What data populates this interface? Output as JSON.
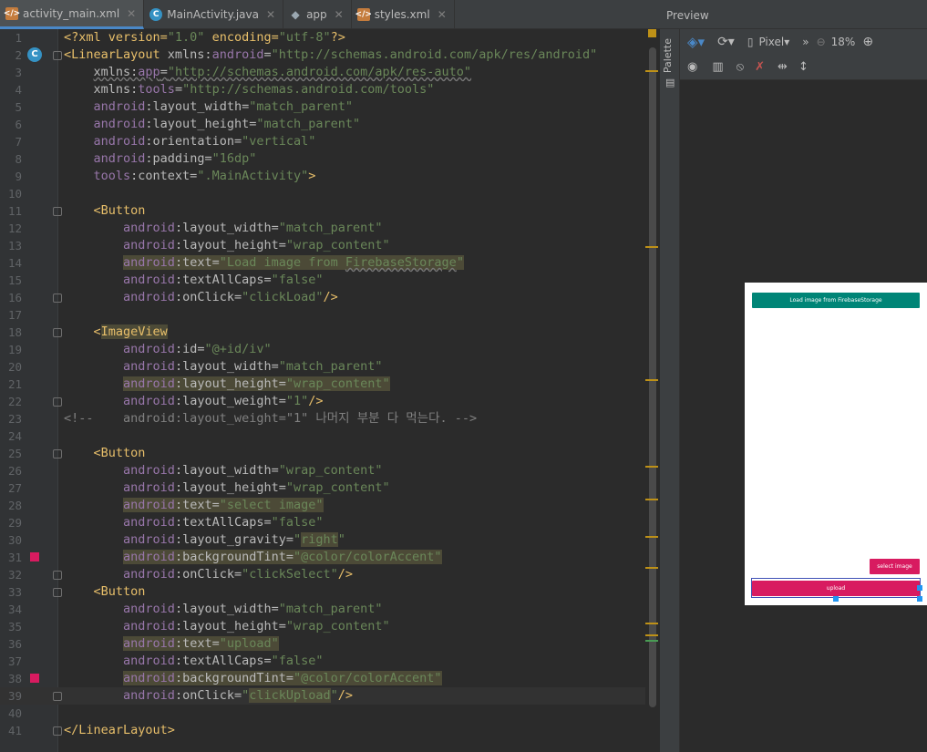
{
  "tabs": [
    {
      "label": "activity_main.xml",
      "icon": "xml-file-icon",
      "active": true
    },
    {
      "label": "MainActivity.java",
      "icon": "java-class-icon",
      "active": false
    },
    {
      "label": "app",
      "icon": "module-icon",
      "active": false
    },
    {
      "label": "styles.xml",
      "icon": "xml-file-icon",
      "active": false
    }
  ],
  "code_lines": [
    {
      "n": "1",
      "html": "<span class=\"pi\">&lt;?xml version=</span><span class=\"val\">\"1.0\"</span><span class=\"pi\"> encoding=</span><span class=\"val\">\"utf-8\"</span><span class=\"pi\">?&gt;</span>"
    },
    {
      "n": "2",
      "html": "<span class=\"tag\">&lt;LinearLayout </span><span class=\"attr\">xmlns:</span><span class=\"ns\">android</span><span class=\"attr\">=</span><span class=\"val\">\"http://schemas.android.com/apk/res/android\"</span>"
    },
    {
      "n": "3",
      "html": "    <span class=\"attr err\">xmlns:</span><span class=\"ns err\">app</span><span class=\"attr err\">=</span><span class=\"val err\">\"http://schemas.android.com/apk/res-auto\"</span>"
    },
    {
      "n": "4",
      "html": "    <span class=\"attr\">xmlns:</span><span class=\"ns\">tools</span><span class=\"attr\">=</span><span class=\"val\">\"http://schemas.android.com/tools\"</span>"
    },
    {
      "n": "5",
      "html": "    <span class=\"ns\">android</span><span class=\"attr\">:layout_width=</span><span class=\"val\">\"match_parent\"</span>"
    },
    {
      "n": "6",
      "html": "    <span class=\"ns\">android</span><span class=\"attr\">:layout_height=</span><span class=\"val\">\"match_parent\"</span>"
    },
    {
      "n": "7",
      "html": "    <span class=\"ns\">android</span><span class=\"attr\">:orientation=</span><span class=\"val\">\"vertical\"</span>"
    },
    {
      "n": "8",
      "html": "    <span class=\"ns\">android</span><span class=\"attr\">:padding=</span><span class=\"val\">\"16dp\"</span>"
    },
    {
      "n": "9",
      "html": "    <span class=\"ns\">tools</span><span class=\"attr\">:context=</span><span class=\"val\">\".MainActivity\"</span><span class=\"tag\">&gt;</span>"
    },
    {
      "n": "10",
      "html": ""
    },
    {
      "n": "11",
      "html": "    <span class=\"tag\">&lt;Button</span>"
    },
    {
      "n": "12",
      "html": "        <span class=\"ns\">android</span><span class=\"attr\">:layout_width=</span><span class=\"val\">\"match_parent\"</span>"
    },
    {
      "n": "13",
      "html": "        <span class=\"ns\">android</span><span class=\"attr\">:layout_height=</span><span class=\"val\">\"wrap_content\"</span>"
    },
    {
      "n": "14",
      "html": "        <span class=\"hl\"><span class=\"ns\">android</span><span class=\"attr\">:text=</span><span class=\"val\">\"Load image from <span class=\"err\">FirebaseStorage</span>\"</span></span>"
    },
    {
      "n": "15",
      "html": "        <span class=\"ns\">android</span><span class=\"attr\">:textAllCaps=</span><span class=\"val\">\"false\"</span>"
    },
    {
      "n": "16",
      "html": "        <span class=\"ns\">android</span><span class=\"attr\">:onClick=</span><span class=\"val\">\"clickLoad\"</span><span class=\"tag\">/&gt;</span>"
    },
    {
      "n": "17",
      "html": ""
    },
    {
      "n": "18",
      "html": "    <span class=\"tag\">&lt;<span class=\"hl\">ImageView</span></span>"
    },
    {
      "n": "19",
      "html": "        <span class=\"ns\">android</span><span class=\"attr\">:id=</span><span class=\"val\">\"@+id/iv\"</span>"
    },
    {
      "n": "20",
      "html": "        <span class=\"ns\">android</span><span class=\"attr\">:layout_width=</span><span class=\"val\">\"match_parent\"</span>"
    },
    {
      "n": "21",
      "html": "        <span class=\"hl\"><span class=\"ns\">android</span><span class=\"attr\">:layout_height=</span><span class=\"val\">\"wrap_content\"</span></span>"
    },
    {
      "n": "22",
      "html": "        <span class=\"ns\">android</span><span class=\"attr\">:layout_weight=</span><span class=\"val\">\"1\"</span><span class=\"tag\">/&gt;</span>"
    },
    {
      "n": "23",
      "html": "<span class=\"cmt\">&lt;!--    android:layout_weight=\"1\" 나머지 부분 다 먹는다. --&gt;</span>"
    },
    {
      "n": "24",
      "html": ""
    },
    {
      "n": "25",
      "html": "    <span class=\"tag\">&lt;Button</span>"
    },
    {
      "n": "26",
      "html": "        <span class=\"ns\">android</span><span class=\"attr\">:layout_width=</span><span class=\"val\">\"wrap_content\"</span>"
    },
    {
      "n": "27",
      "html": "        <span class=\"ns\">android</span><span class=\"attr\">:layout_height=</span><span class=\"val\">\"wrap_content\"</span>"
    },
    {
      "n": "28",
      "html": "        <span class=\"hl\"><span class=\"ns\">android</span><span class=\"attr\">:text=</span><span class=\"val\">\"select image\"</span></span>"
    },
    {
      "n": "29",
      "html": "        <span class=\"ns\">android</span><span class=\"attr\">:textAllCaps=</span><span class=\"val\">\"false\"</span>"
    },
    {
      "n": "30",
      "html": "        <span class=\"ns\">android</span><span class=\"attr\">:layout_gravity=</span><span class=\"val\">\"<span class=\"hl\">right</span>\"</span>"
    },
    {
      "n": "31",
      "html": "        <span class=\"hl\"><span class=\"ns\">android</span><span class=\"attr\">:backgroundTint=</span><span class=\"val\">\"@color/colorAccent\"</span></span>"
    },
    {
      "n": "32",
      "html": "        <span class=\"ns\">android</span><span class=\"attr\">:onClick=</span><span class=\"val\">\"clickSelect\"</span><span class=\"tag\">/&gt;</span>"
    },
    {
      "n": "33",
      "html": "    <span class=\"tag\">&lt;Button</span>"
    },
    {
      "n": "34",
      "html": "        <span class=\"ns\">android</span><span class=\"attr\">:layout_width=</span><span class=\"val\">\"match_parent\"</span>"
    },
    {
      "n": "35",
      "html": "        <span class=\"ns\">android</span><span class=\"attr\">:layout_height=</span><span class=\"val\">\"wrap_content\"</span>"
    },
    {
      "n": "36",
      "html": "        <span class=\"hl\"><span class=\"ns\">android</span><span class=\"attr\">:text=</span><span class=\"val\">\"upload\"</span></span>"
    },
    {
      "n": "37",
      "html": "        <span class=\"ns\">android</span><span class=\"attr\">:textAllCaps=</span><span class=\"val\">\"false\"</span>"
    },
    {
      "n": "38",
      "html": "        <span class=\"hl\"><span class=\"ns\">android</span><span class=\"attr\">:backgroundTint=</span><span class=\"val\">\"@color/colorAccent\"</span></span>"
    },
    {
      "n": "39",
      "html": "        <span class=\"ns\">android</span><span class=\"attr\">:onClick=</span><span class=\"val\">\"<span class=\"hl\">clickUpload</span>\"</span><span class=\"tag\">/&gt;</span>"
    },
    {
      "n": "40",
      "html": ""
    },
    {
      "n": "41",
      "html": "<span class=\"tag\">&lt;/LinearLayout&gt;</span>"
    }
  ],
  "code_text": [
    "<?xml version=\"1.0\" encoding=\"utf-8\"?>",
    "<LinearLayout xmlns:android=\"http://schemas.android.com/apk/res/android\"",
    "xmlns:app=\"http://schemas.android.com/apk/res-auto\"",
    "xmlns:tools=\"http://schemas.android.com/tools\"",
    "android:layout_width=\"match_parent\"",
    "android:layout_height=\"match_parent\"",
    "android:orientation=\"vertical\"",
    "android:padding=\"16dp\"",
    "tools:context=\".MainActivity\">",
    "",
    "<Button",
    "android:layout_width=\"match_parent\"",
    "android:layout_height=\"wrap_content\"",
    "android:text=\"Load image from FirebaseStorage\"",
    "android:textAllCaps=\"false\"",
    "android:onClick=\"clickLoad\"/>",
    "",
    "<ImageView",
    "android:id=\"@+id/iv\"",
    "android:layout_width=\"match_parent\"",
    "android:layout_height=\"wrap_content\"",
    "android:layout_weight=\"1\"/>",
    "<!--    android:layout_weight=\"1\" 나머지 부분 다 먹는다. -->",
    "",
    "<Button",
    "android:layout_width=\"wrap_content\"",
    "android:layout_height=\"wrap_content\"",
    "android:text=\"select image\"",
    "android:textAllCaps=\"false\"",
    "android:layout_gravity=\"right\"",
    "android:backgroundTint=\"@color/colorAccent\"",
    "android:onClick=\"clickSelect\"/>",
    "<Button",
    "android:layout_width=\"match_parent\"",
    "android:layout_height=\"wrap_content\"",
    "android:text=\"upload\"",
    "android:textAllCaps=\"false\"",
    "android:backgroundTint=\"@color/colorAccent\"",
    "android:onClick=\"clickUpload\"/>",
    "",
    "</LinearLayout>"
  ],
  "gutter": {
    "class_marker_line": 2,
    "class_marker_label": "C",
    "color_markers_lines": [
      31,
      38
    ],
    "fold_lines": [
      2,
      11,
      16,
      18,
      22,
      25,
      32,
      33,
      39,
      41
    ],
    "current_line": 39
  },
  "preview": {
    "title": "Preview",
    "palette_label": "Palette",
    "device": "Pixel",
    "zoom": "18%",
    "buttons": {
      "load": "Load image from FirebaseStorage",
      "select": "select image",
      "upload": "upload"
    },
    "colors": {
      "primary": "#008577",
      "accent": "#d81b60"
    }
  }
}
